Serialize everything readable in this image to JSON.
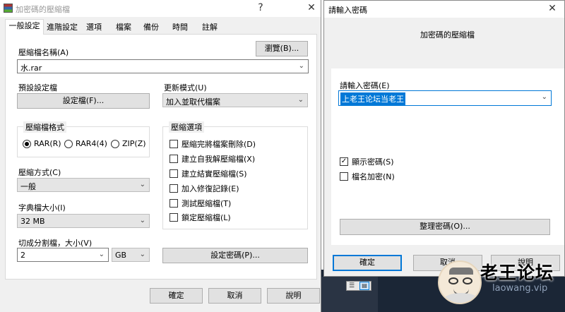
{
  "left_window": {
    "title": "加密碼的壓縮檔",
    "tabs": [
      "一般設定",
      "進階設定",
      "選項",
      "檔案",
      "備份",
      "時間",
      "註解"
    ],
    "archive_name_label": "壓縮檔名稱(A)",
    "browse_label": "瀏覽(B)...",
    "archive_name_value": "水.rar",
    "default_profile_label": "預設設定檔",
    "profiles_button": "設定檔(F)...",
    "update_mode_label": "更新模式(U)",
    "update_mode_value": "加入並取代檔案",
    "format_group_title": "壓縮檔格式",
    "formats": [
      "RAR(R)",
      "RAR4(4)",
      "ZIP(Z)"
    ],
    "selected_format_index": 0,
    "options_group_title": "壓縮選項",
    "options": [
      {
        "label": "壓縮完將檔案刪除(D)",
        "checked": false
      },
      {
        "label": "建立自我解壓縮檔(X)",
        "checked": false
      },
      {
        "label": "建立結實壓縮檔(S)",
        "checked": false
      },
      {
        "label": "加入修復記錄(E)",
        "checked": false
      },
      {
        "label": "測試壓縮檔(T)",
        "checked": false
      },
      {
        "label": "鎖定壓縮檔(L)",
        "checked": false
      }
    ],
    "method_label": "壓縮方式(C)",
    "method_value": "一般",
    "dict_label": "字典檔大小(I)",
    "dict_value": "32 MB",
    "split_label": "切成分割檔，大小(V)",
    "split_value": "2",
    "split_unit": "GB",
    "set_password_button": "設定密碼(P)...",
    "ok_button": "確定",
    "cancel_button": "取消",
    "help_button": "說明"
  },
  "right_window": {
    "title": "請輸入密碼",
    "subtitle": "加密碼的壓縮檔",
    "password_label": "請輸入密碼(E)",
    "password_value": "上老王论坛当老王",
    "show_password_label": "顯示密碼(S)",
    "show_password_checked": true,
    "encrypt_names_label": "檔名加密(N)",
    "encrypt_names_checked": false,
    "organize_button": "整理密碼(O)...",
    "ok_button": "確定",
    "cancel_button": "取消",
    "help_button": "說明"
  },
  "watermark": {
    "text": "老王论坛",
    "url": "laowang.vip"
  },
  "colors": {
    "accent": "#0078d7",
    "selection": "#0078d7",
    "dark_bg": "#1b2636"
  }
}
